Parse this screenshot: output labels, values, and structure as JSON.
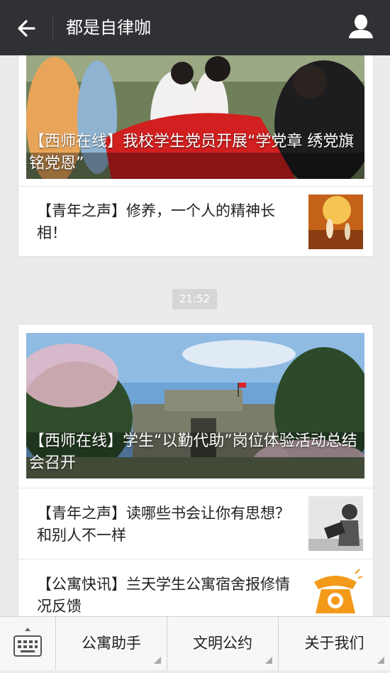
{
  "header": {
    "title": "都是自律咖",
    "back_icon": "arrow-left-icon",
    "profile_icon": "person-icon"
  },
  "feed": {
    "card1": {
      "hero_caption": "【西师在线】我校学生党员开展“学党章 绣党旗 铭党恩”",
      "items": [
        {
          "title": "【青年之声】修养，一个人的精神长相！"
        }
      ]
    },
    "timestamp": "21:52",
    "card2": {
      "hero_caption": "【西师在线】学生“以勤代助”岗位体验活动总结会召开",
      "items": [
        {
          "title": "【青年之声】读哪些书会让你有思想？和别人不一样"
        },
        {
          "title": "【公寓快讯】兰天学生公寓宿舍报修情况反馈"
        }
      ]
    }
  },
  "bottom_menu": {
    "keyboard_icon": "keyboard-icon",
    "items": [
      {
        "label": "公寓助手"
      },
      {
        "label": "文明公约"
      },
      {
        "label": "关于我们"
      }
    ]
  },
  "colors": {
    "header_bg": "#2f3135",
    "page_bg": "#ebebeb",
    "timestamp_bg": "#d6d6d6"
  }
}
